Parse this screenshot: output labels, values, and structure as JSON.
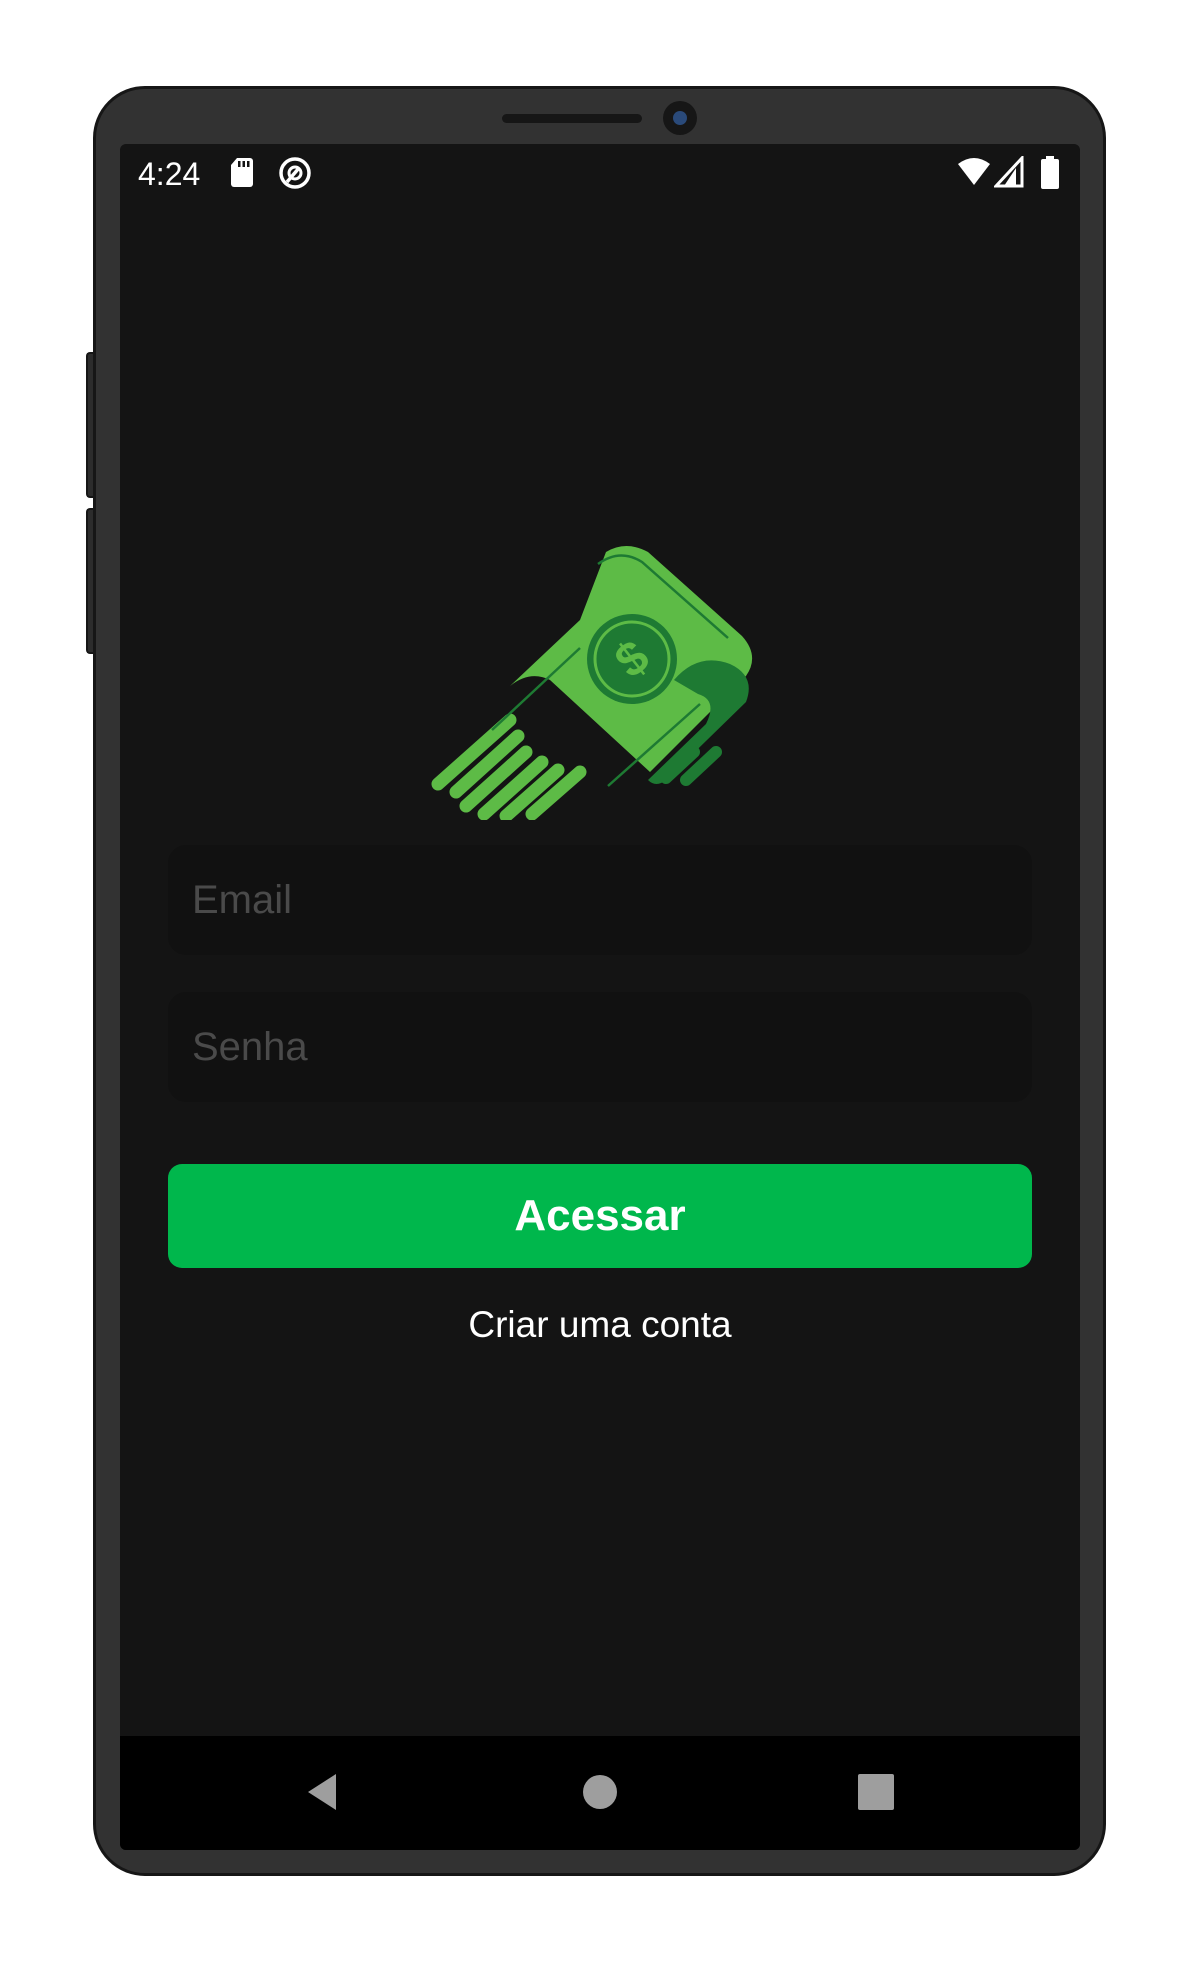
{
  "status_bar": {
    "time": "4:24",
    "left_icons": [
      "sd-card-icon",
      "app-notification-icon"
    ],
    "right_icons": [
      "wifi-icon",
      "cellular-signal-icon",
      "battery-icon"
    ]
  },
  "logo": {
    "icon": "flying-money-icon",
    "symbol": "$"
  },
  "login_form": {
    "email": {
      "placeholder": "Email",
      "value": ""
    },
    "password": {
      "placeholder": "Senha",
      "value": ""
    },
    "submit_label": "Acessar",
    "create_account_label": "Criar uma conta"
  },
  "nav_bar": {
    "buttons": [
      "back-icon",
      "home-icon",
      "recents-icon"
    ]
  },
  "colors": {
    "background": "#141414",
    "accent": "#00b74c",
    "input_bg": "#111111",
    "placeholder": "#4a4a4a",
    "logo_light_green": "#5dbb46",
    "logo_dark_green": "#1e7a33"
  }
}
